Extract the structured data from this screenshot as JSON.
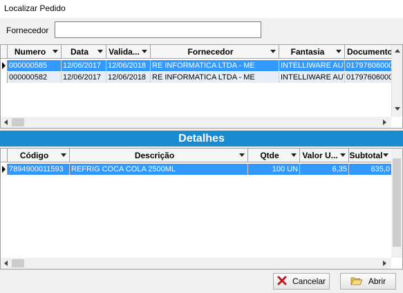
{
  "window": {
    "title": "Localizar Pedido"
  },
  "filter": {
    "label": "Fornecedor",
    "value": ""
  },
  "orders": {
    "columns": [
      "Numero",
      "Data",
      "Valida...",
      "Fornecedor",
      "Fantasia",
      "Documento"
    ],
    "rows": [
      [
        "000000585",
        "12/06/2017",
        "12/06/2018",
        "RE INFORMATICA LTDA - ME",
        "INTELLIWARE AUTOMAÇÃO",
        "01797606000"
      ],
      [
        "000000582",
        "12/06/2017",
        "12/06/2018",
        "RE INFORMATICA LTDA - ME",
        "INTELLIWARE AUTOMAÇÃO",
        "01797606000"
      ]
    ]
  },
  "details": {
    "title": "Detalhes",
    "columns": [
      "Código",
      "Descrição",
      "Qtde",
      "Valor U...",
      "Subtotal"
    ],
    "rows": [
      [
        "7894900011593",
        "REFRIG COCA COLA 2500ML",
        "100 UN",
        "6,35",
        "635,0"
      ]
    ]
  },
  "buttons": {
    "cancel": "Cancelar",
    "open": "Abrir"
  },
  "icons": {
    "cancel": "close-x-icon",
    "open": "folder-open-icon"
  },
  "colors": {
    "selection": "#3399ff",
    "section_header": "#1a8bd0"
  }
}
